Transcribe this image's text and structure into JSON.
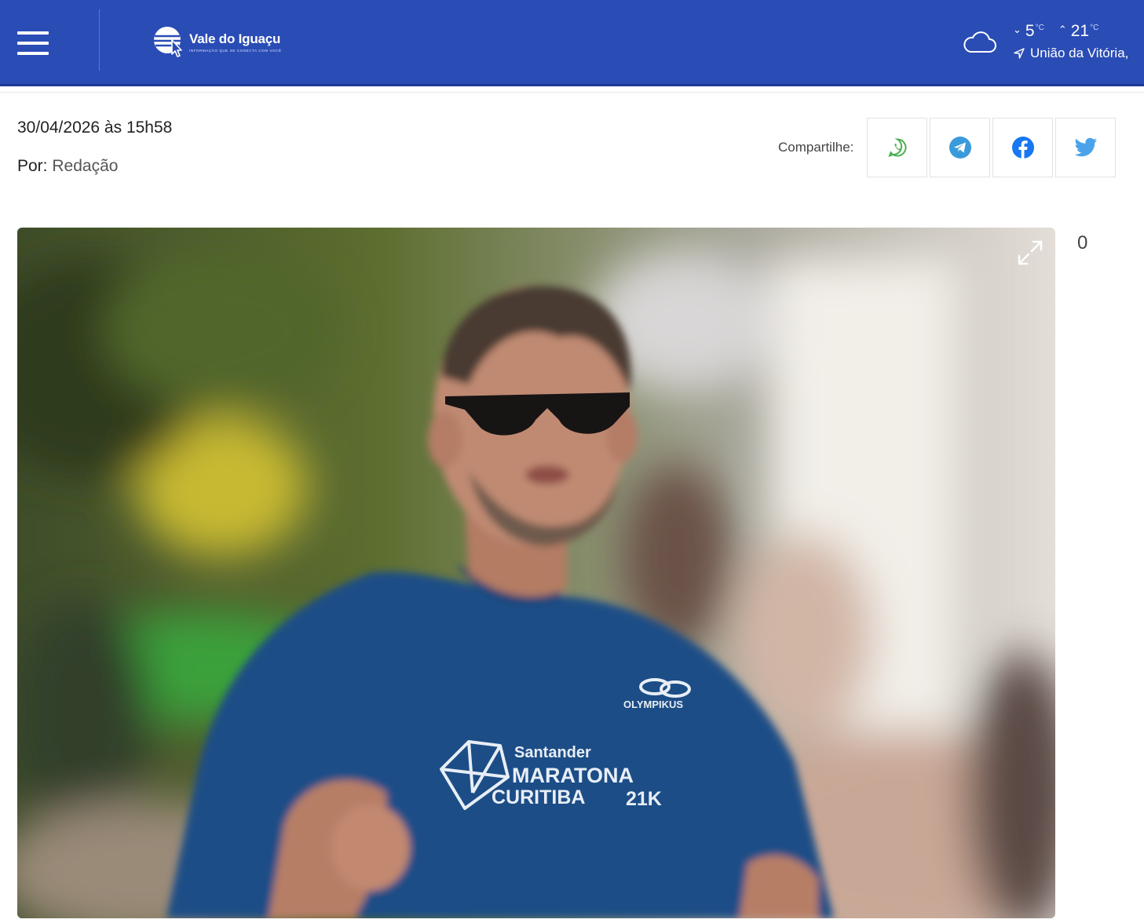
{
  "header": {
    "menu_icon": "hamburger-icon",
    "logo": {
      "title": "Vale do Iguaçu",
      "tagline": "INFORMAÇÃO QUE SE CONECTA COM VOCÊ"
    },
    "weather": {
      "icon": "cloud-icon",
      "min_temp": "5",
      "max_temp": "21",
      "unit": "°C",
      "location": "União da Vitória,"
    },
    "colors": {
      "bar": "#2a4cb5",
      "bar_border": "#1d3a96"
    }
  },
  "article": {
    "date": "30/04/2026 às 15h58",
    "author_label": "Por:",
    "author": "Redação",
    "share_label": "Compartilhe:",
    "share_buttons": [
      {
        "icon": "whatsapp-icon",
        "color": "#4caf50"
      },
      {
        "icon": "telegram-icon",
        "color": "#3a9bdc"
      },
      {
        "icon": "facebook-icon",
        "color": "#1877f2"
      },
      {
        "icon": "twitter-icon",
        "color": "#4aa3ea"
      }
    ],
    "image": {
      "shirt_brand": "OLYMPIKUS",
      "shirt_sponsor": "Santander",
      "shirt_line1": "MARATONA",
      "shirt_line2": "CURITIBA",
      "shirt_distance": "21K",
      "expand_icon": "expand-icon"
    },
    "side_count": "0"
  }
}
